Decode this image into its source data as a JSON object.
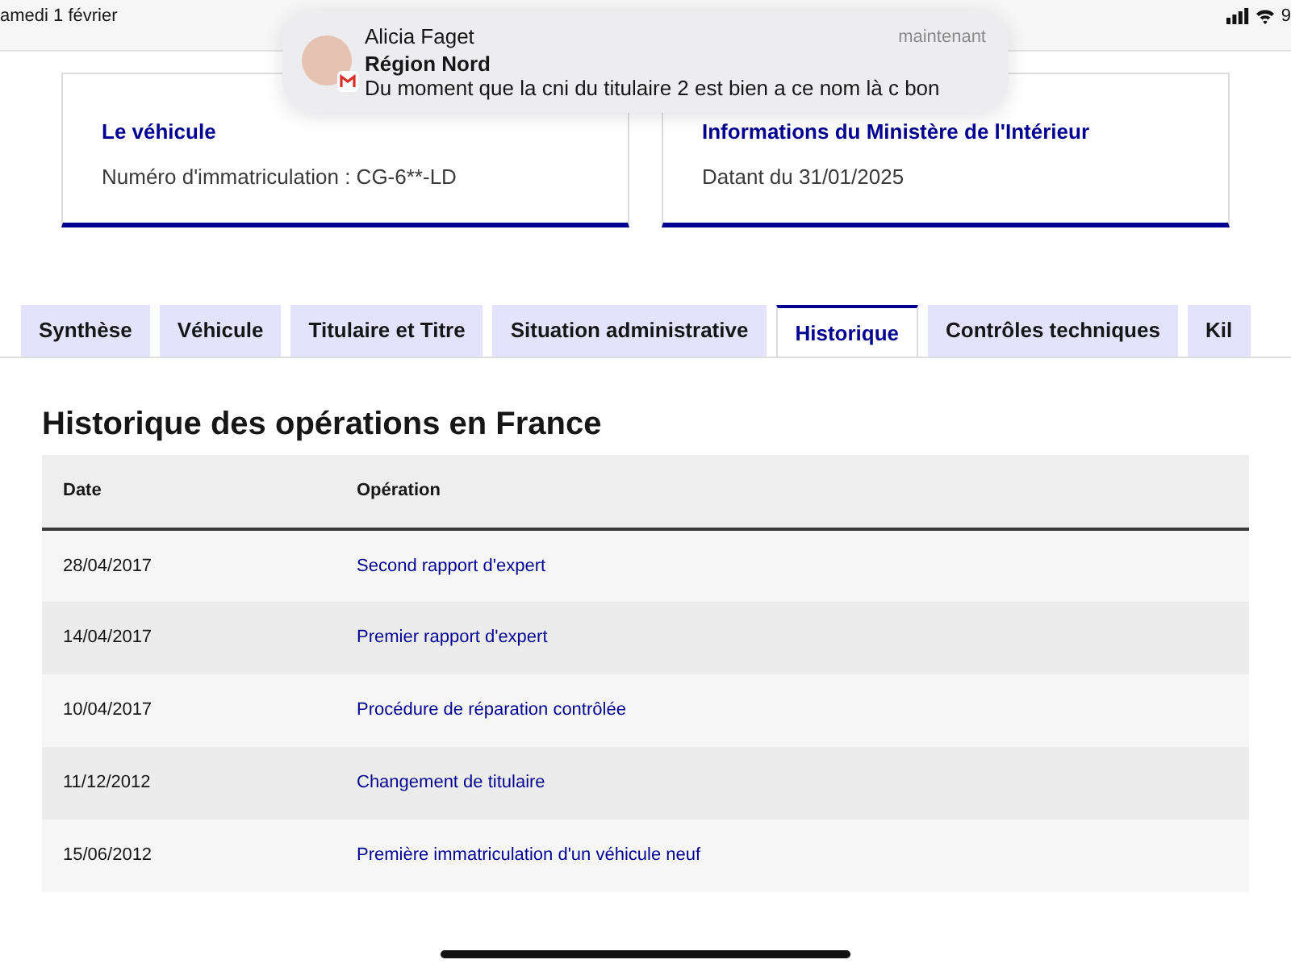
{
  "status_bar": {
    "date": "amedi 1 février",
    "battery": "9"
  },
  "notification": {
    "sender": "Alicia Faget",
    "group": "Région Nord",
    "message": "Du moment que la cni du titulaire 2 est bien a ce nom là c bon",
    "time": "maintenant"
  },
  "cards": [
    {
      "title": "Le véhicule",
      "text": "Numéro d'immatriculation : CG-6**-LD"
    },
    {
      "title": "Informations du Ministère de l'Intérieur",
      "text": "Datant du 31/01/2025"
    }
  ],
  "tabs": [
    {
      "label": "Synthèse",
      "selected": false
    },
    {
      "label": "Véhicule",
      "selected": false
    },
    {
      "label": "Titulaire et Titre",
      "selected": false
    },
    {
      "label": "Situation administrative",
      "selected": false
    },
    {
      "label": "Historique",
      "selected": true
    },
    {
      "label": "Contrôles techniques",
      "selected": false
    },
    {
      "label": "Kil",
      "selected": false
    }
  ],
  "section_title": "Historique des opérations en France",
  "table": {
    "columns": [
      "Date",
      "Opération"
    ],
    "rows": [
      [
        "28/04/2017",
        "Second rapport d'expert"
      ],
      [
        "14/04/2017",
        "Premier rapport d'expert"
      ],
      [
        "10/04/2017",
        "Procédure de réparation contrôlée"
      ],
      [
        "11/12/2012",
        "Changement de titulaire"
      ],
      [
        "15/06/2012",
        "Première immatriculation d'un véhicule neuf"
      ]
    ]
  }
}
